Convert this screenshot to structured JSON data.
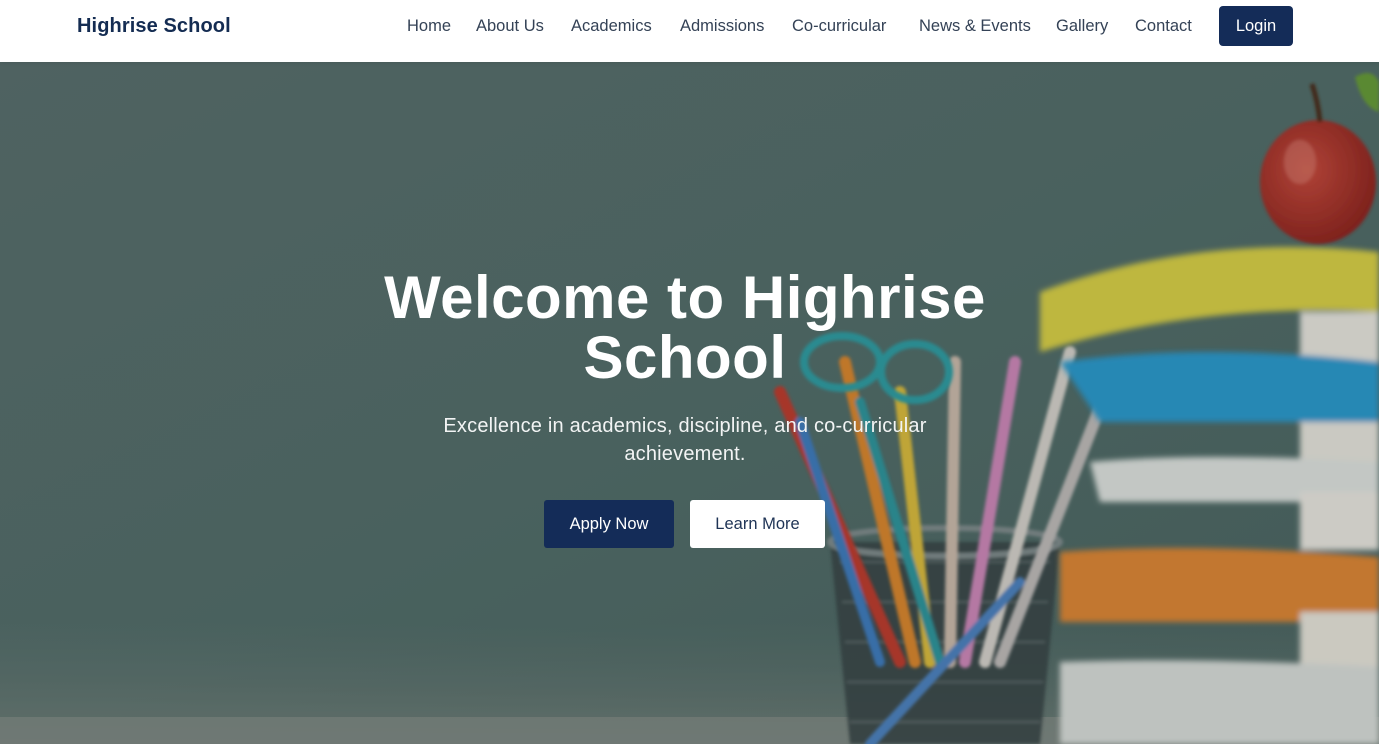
{
  "brand": {
    "name": "Highrise School"
  },
  "nav": {
    "items": [
      {
        "label": "Home"
      },
      {
        "label": "About Us"
      },
      {
        "label": "Academics"
      },
      {
        "label": "Admissions"
      },
      {
        "label": "Co-curricular"
      },
      {
        "label": "News & Events"
      },
      {
        "label": "Gallery"
      },
      {
        "label": "Contact"
      }
    ],
    "login_label": "Login"
  },
  "hero": {
    "title_line1": "Welcome to Highrise",
    "title_line2": "School",
    "subtitle_line1": "Excellence in academics, discipline, and co-curricular",
    "subtitle_line2": "achievement.",
    "primary_cta": "Apply Now",
    "secondary_cta": "Learn More",
    "background_image": "school-supplies-photo"
  },
  "colors": {
    "brand_navy": "#142c58",
    "nav_text": "#344256",
    "hero_text": "#ffffff"
  }
}
